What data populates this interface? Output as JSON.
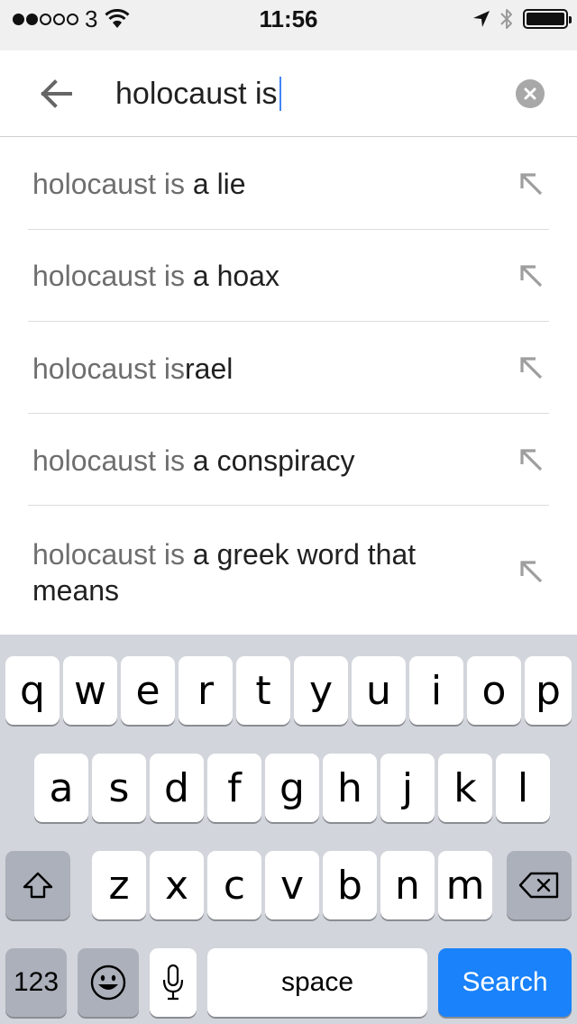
{
  "status_bar": {
    "carrier": "3",
    "time": "11:56"
  },
  "search": {
    "query": "holocaust is"
  },
  "suggestions": [
    {
      "prefix": "holocaust is",
      "suffix": " a lie"
    },
    {
      "prefix": "holocaust is",
      "suffix": " a hoax"
    },
    {
      "prefix": "holocaust is",
      "suffix": "rael"
    },
    {
      "prefix": "holocaust is",
      "suffix": " a conspiracy"
    },
    {
      "prefix": "holocaust is",
      "suffix": " a greek word that means"
    }
  ],
  "keyboard": {
    "row1": [
      "q",
      "w",
      "e",
      "r",
      "t",
      "y",
      "u",
      "i",
      "o",
      "p"
    ],
    "row2": [
      "a",
      "s",
      "d",
      "f",
      "g",
      "h",
      "j",
      "k",
      "l"
    ],
    "row3": [
      "z",
      "x",
      "c",
      "v",
      "b",
      "n",
      "m"
    ],
    "numbers_label": "123",
    "space_label": "space",
    "search_label": "Search"
  },
  "colors": {
    "accent": "#1a82fb",
    "caret": "#4285f4"
  }
}
